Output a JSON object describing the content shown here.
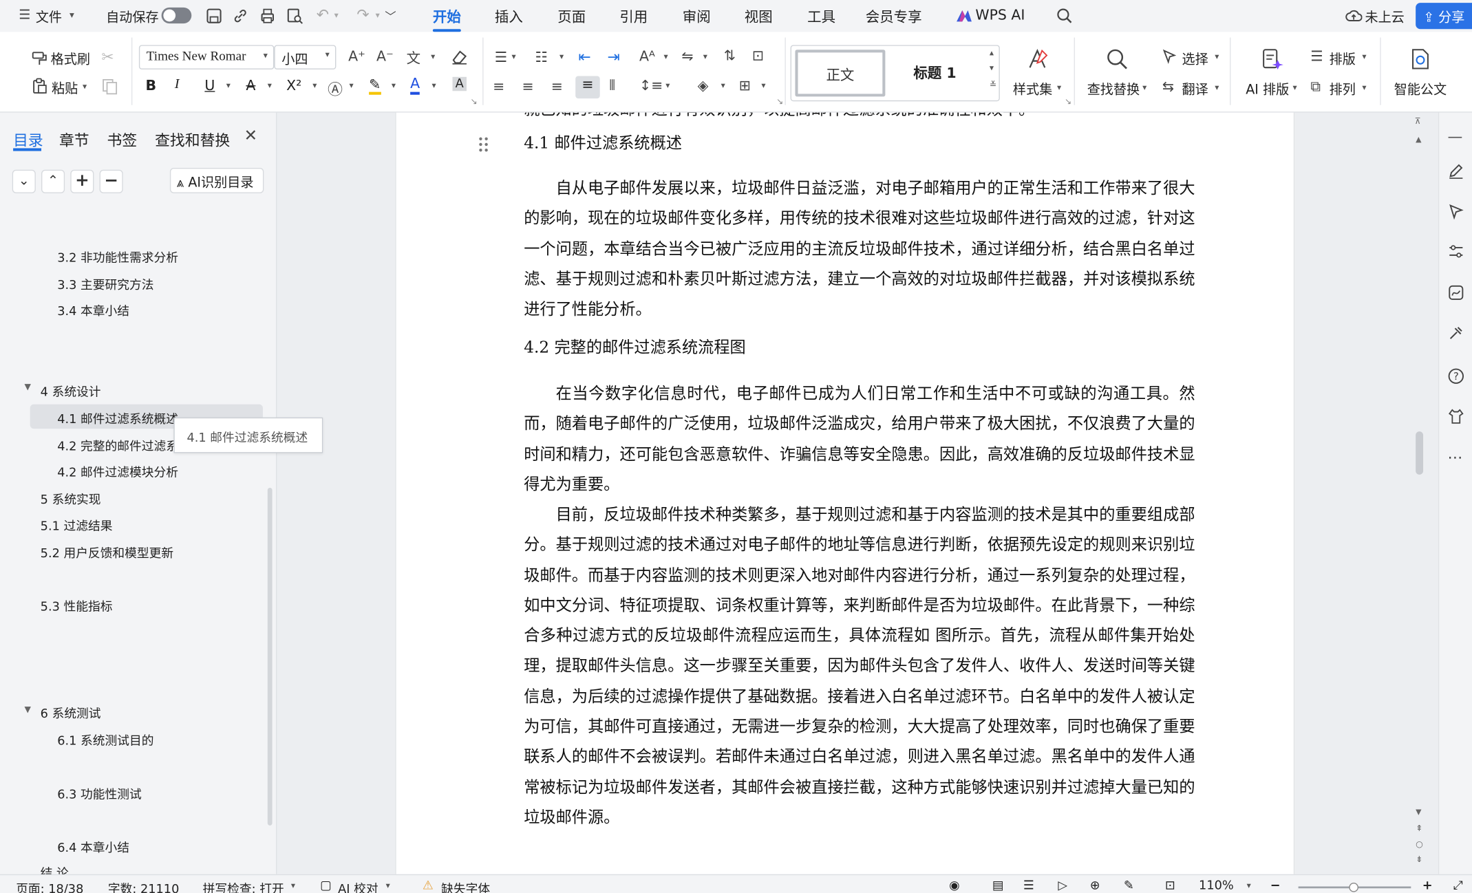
{
  "topbar": {
    "file_menu": "文件",
    "autosave": "自动保存",
    "tabs": [
      "开始",
      "插入",
      "页面",
      "引用",
      "审阅",
      "视图",
      "工具",
      "会员专享",
      "WPS AI"
    ],
    "cloud": "未上云",
    "share": "分享"
  },
  "ribbon": {
    "format_painter": "格式刷",
    "paste": "粘贴",
    "font_name": "Times New Romar",
    "font_size": "小四",
    "style_normal": "正文",
    "style_heading1": "标题 1",
    "style_set": "样式集",
    "find_replace": "查找替换",
    "select": "选择",
    "translate": "翻译",
    "ai_layout": "AI 排版",
    "typeset": "排版",
    "arrange": "排列",
    "smart_doc": "智能公文"
  },
  "left_panel": {
    "tabs": [
      "目录",
      "章节",
      "书签",
      "查找和替换"
    ],
    "ai_toc_button": "AI识别目录",
    "toc": [
      {
        "text": "3.2 非功能性需求分析"
      },
      {
        "text": "3.3 主要研究方法"
      },
      {
        "text": "3.4 本章小结"
      },
      {
        "text": "4 系统设计"
      },
      {
        "text": "4.1  邮件过滤系统概述"
      },
      {
        "text": "4.2  完整的邮件过滤系"
      },
      {
        "text": "4.2     邮件过滤模块分析"
      },
      {
        "text": "5 系统实现"
      },
      {
        "text": "5.1 过滤结果"
      },
      {
        "text": "5.2  用户反馈和模型更新"
      },
      {
        "text": "5.3  性能指标"
      },
      {
        "text": "6  系统测试"
      },
      {
        "text": "6.1  系统测试目的"
      },
      {
        "text": "6.3  功能性测试"
      },
      {
        "text": "6.4  本章小结"
      },
      {
        "text": "结  论"
      }
    ],
    "tooltip": "4.1 邮件过滤系统概述"
  },
  "document": {
    "heading_4_1": "4.1  邮件过滤系统概述",
    "para_1": "自从电子邮件发展以来，垃圾邮件日益泛滥，对电子邮箱用户的正常生活和工作带来了很大的影响，现在的垃圾邮件变化多样，用传统的技术很难对这些垃圾邮件进行高效的过滤，针对这一个问题，本章结合当今已被广泛应用的主流反垃圾邮件技术，通过详细分析，结合黑白名单过滤、基于规则过滤和朴素贝叶斯过滤方法，建立一个高效的对垃圾邮件拦截器，并对该模拟系统进行了性能分析。",
    "heading_4_2": "4.2  完整的邮件过滤系统流程图",
    "para_2": "在当今数字化信息时代，电子邮件已成为人们日常工作和生活中不可或缺的沟通工具。然而，随着电子邮件的广泛使用，垃圾邮件泛滥成灾，给用户带来了极大困扰，不仅浪费了大量的时间和精力，还可能包含恶意软件、诈骗信息等安全隐患。因此，高效准确的反垃圾邮件技术显得尤为重要。",
    "para_3": "目前，反垃圾邮件技术种类繁多，基于规则过滤和基于内容监测的技术是其中的重要组成部分。基于规则过滤的技术通过对电子邮件的地址等信息进行判断，依据预先设定的规则来识别垃圾邮件。而基于内容监测的技术则更深入地对邮件内容进行分析，通过一系列复杂的处理过程，如中文分词、特征项提取、词条权重计算等，来判断邮件是否为垃圾邮件。在此背景下，一种综合多种过滤方式的反垃圾邮件流程应运而生，具体流程如  图所示。首先，流程从邮件集开始处理，提取邮件头信息。这一步骤至关重要，因为邮件头包含了发件人、收件人、发送时间等关键信息，为后续的过滤操作提供了基础数据。接着进入白名单过滤环节。白名单中的发件人被认定为可信，其邮件可直接通过，无需进一步复杂的检测，大大提高了处理效率，同时也确保了重要联系人的邮件不会被误判。若邮件未通过白名单过滤，则进入黑名单过滤。黑名单中的发件人通常被标记为垃圾邮件发送者，其邮件会被直接拦截，这种方式能够快速识别并过滤掉大量已知的垃圾邮件源。",
    "para_cut": "就已知的垃圾邮件进行有效识别，以提高邮件过滤系统的准确性和效率。"
  },
  "statusbar": {
    "page": "页面: 18/38",
    "words": "字数: 21110",
    "spell": "拼写检查: 打开",
    "ai_check": "AI 校对",
    "missing_font": "缺失字体",
    "zoom": "110%"
  }
}
